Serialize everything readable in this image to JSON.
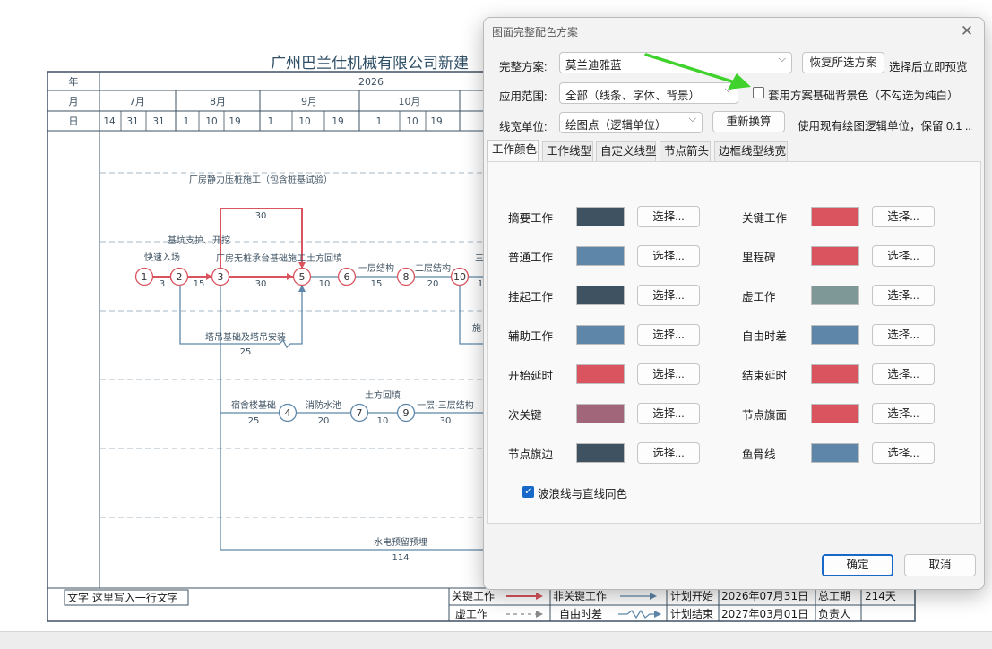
{
  "document": {
    "title": "广州巴兰仕机械有限公司新建",
    "header": {
      "year_label": "年",
      "month_label": "月",
      "day_label": "日",
      "year_value": "2026",
      "months": [
        "7月",
        "8月",
        "9月",
        "10月"
      ],
      "days": [
        "14",
        "31",
        "31",
        "1",
        "10",
        "19",
        "1",
        "10",
        "19",
        "1",
        "10",
        "19"
      ]
    },
    "tasks": {
      "quick_entry": "快速入场",
      "quick_entry_dur": "3",
      "pit_support": "基坑支护、开挖",
      "pit_support_dur": "15",
      "static_pile": "厂房静力压桩施工（包含桩基试验）",
      "static_pile_dur": "30",
      "pile_cap": "厂房无桩承台基础施工",
      "pile_cap_dur": "30",
      "backfill": "土方回填",
      "backfill_dur": "10",
      "floor1": "一层结构",
      "floor1_dur": "15",
      "floor2": "二层结构",
      "floor2_dur": "20",
      "tower_crane": "塔吊基础及塔吊安装",
      "tower_crane_dur": "25",
      "dorm_foundation": "宿舍楼基础",
      "dorm_foundation_dur": "25",
      "fire_pool": "消防水池",
      "fire_pool_dur": "20",
      "dorm_backfill": "土方回填",
      "dorm_backfill_dur": "10",
      "floors_1_3": "一层-三层结构",
      "floors_1_3_dur": "30",
      "mep_embed": "水电预留预埋",
      "mep_embed_dur": "114",
      "partial_1": "施",
      "partial_2": "三",
      "partial_3": "1",
      "nodes": [
        "1",
        "2",
        "3",
        "5",
        "6",
        "8",
        "10",
        "4",
        "7",
        "9"
      ]
    },
    "footer": {
      "text_box": "文字 这里写入一行文字",
      "critical_label": "关键工作",
      "noncritical_label": "非关键工作",
      "plan_start_label": "计划开始",
      "plan_start_value": "2026年07月31日",
      "total_period_label": "总工期",
      "total_period_value": "214天",
      "virtual_label": "虚工作",
      "free_float_label": "自由时差",
      "plan_end_label": "计划结束",
      "plan_end_value": "2027年03月01日",
      "owner_label": "负责人"
    }
  },
  "dialog": {
    "title": "图面完整配色方案",
    "scheme_label": "完整方案:",
    "scheme_value": "莫兰迪雅蓝",
    "restore_button": "恢复所选方案",
    "scheme_hint": "选择后立即预览",
    "scope_label": "应用范围:",
    "scope_value": "全部（线条、字体、背景）",
    "apply_bg_label": "套用方案基础背景色（不勾选为纯白）",
    "apply_bg_checked": false,
    "unit_label": "线宽单位:",
    "unit_value": "绘图点（逻辑单位）",
    "recalc_button": "重新换算",
    "unit_hint": "使用现有绘图逻辑单位，保留 0.1 ...",
    "tabs": [
      "工作颜色",
      "工作线型",
      "自定义线型",
      "节点箭头",
      "边框线型线宽"
    ],
    "active_tab": 0,
    "pick_label": "选择...",
    "colors_left": [
      {
        "label": "摘要工作",
        "color": "#3e5262"
      },
      {
        "label": "普通工作",
        "color": "#5d86a8"
      },
      {
        "label": "挂起工作",
        "color": "#3e5262"
      },
      {
        "label": "辅助工作",
        "color": "#5d86a8"
      },
      {
        "label": "开始延时",
        "color": "#d9545f"
      },
      {
        "label": "次关键",
        "color": "#a2667a"
      },
      {
        "label": "节点旗边",
        "color": "#3e5262"
      }
    ],
    "colors_right": [
      {
        "label": "关键工作",
        "color": "#d9545f"
      },
      {
        "label": "里程碑",
        "color": "#d9545f"
      },
      {
        "label": "虚工作",
        "color": "#7e9797"
      },
      {
        "label": "自由时差",
        "color": "#5d86a8"
      },
      {
        "label": "结束延时",
        "color": "#d9545f"
      },
      {
        "label": "节点旗面",
        "color": "#d9545f"
      },
      {
        "label": "鱼骨线",
        "color": "#5d86a8"
      }
    ],
    "wave_same_label": "波浪线与直线同色",
    "wave_same_checked": true,
    "ok_button": "确定",
    "cancel_button": "取消"
  },
  "colors": {
    "critical": "#d9545f",
    "normal": "#5d86a8",
    "annotation_arrow": "#3fd12c",
    "accent": "#1768c8"
  }
}
